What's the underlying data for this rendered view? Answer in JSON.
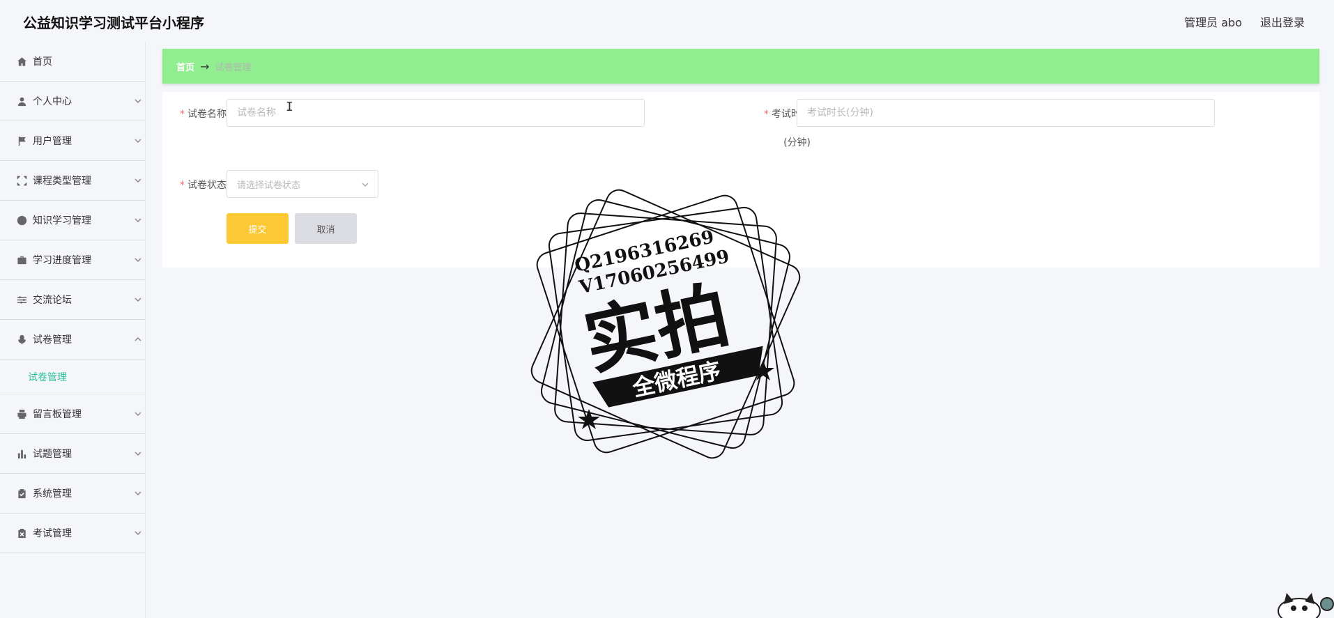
{
  "app": {
    "title": "公益知识学习测试平台小程序"
  },
  "header": {
    "user_label": "管理员 abo",
    "logout_label": "退出登录"
  },
  "sidebar": {
    "items": [
      {
        "label": "首页",
        "icon": "home-icon"
      },
      {
        "label": "个人中心",
        "icon": "user-icon"
      },
      {
        "label": "用户管理",
        "icon": "flag-icon"
      },
      {
        "label": "课程类型管理",
        "icon": "frame-icon"
      },
      {
        "label": "知识学习管理",
        "icon": "lifebuoy-icon"
      },
      {
        "label": "学习进度管理",
        "icon": "briefcase-icon"
      },
      {
        "label": "交流论坛",
        "icon": "sliders-icon"
      },
      {
        "label": "试卷管理",
        "icon": "microphone-icon"
      },
      {
        "label": "留言板管理",
        "icon": "printer-icon"
      },
      {
        "label": "试题管理",
        "icon": "bar-chart-icon"
      },
      {
        "label": "系统管理",
        "icon": "clipboard-check-icon"
      },
      {
        "label": "考试管理",
        "icon": "clipboard-x-icon"
      }
    ],
    "submenu": {
      "label": "试卷管理"
    }
  },
  "breadcrumb": {
    "home": "首页",
    "arrow": "→",
    "current": "试卷管理"
  },
  "form": {
    "name_label": "试卷名称",
    "name_placeholder": "试卷名称",
    "duration_label": "考试时长",
    "duration_unit": "(分钟)",
    "duration_placeholder": "考试时长(分钟)",
    "status_label": "试卷状态",
    "status_placeholder": "请选择试卷状态",
    "required_mark": "*",
    "submit_label": "提交",
    "cancel_label": "取消"
  },
  "watermark": {
    "line1": "Q2196316269",
    "line2": "V17060256499",
    "big_text": "实拍",
    "ribbon_text": "全微程序"
  },
  "colors": {
    "breadcrumb_bg": "#90ee90",
    "submit_bg": "#fcc934",
    "cancel_bg": "#dcdde2",
    "active_submenu": "#2bbf9a",
    "required": "#f56c6c"
  }
}
